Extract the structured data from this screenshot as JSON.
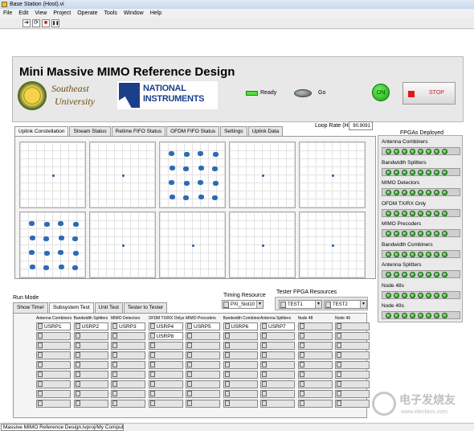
{
  "window": {
    "title": "Base Station (Host).vi"
  },
  "menu": [
    "File",
    "Edit",
    "View",
    "Project",
    "Operate",
    "Tools",
    "Window",
    "Help"
  ],
  "toolbar": {
    "run": "➔",
    "run_continuous": "⟳",
    "abort": "■",
    "pause": "❚❚"
  },
  "header": {
    "title": "Mini Massive MIMO Reference Design",
    "seu_line1": "Southeast",
    "seu_line2": "University",
    "ni_line1": "NATIONAL",
    "ni_line2": "INSTRUMENTS",
    "ready_label": "Ready",
    "go_label": "Go",
    "on_label": "ON",
    "stop_label": "STOP"
  },
  "loop_rate": {
    "label": "Loop Rate (Hz)",
    "value": "90.9091"
  },
  "tabs": [
    "Uplink Constellation",
    "Stream Status",
    "Retime FIFO Status",
    "OFDM FIFO Status",
    "Settings",
    "Uplink Data"
  ],
  "fpgas": {
    "title": "FPGAs Deployed",
    "rows": [
      "Antenna Combiners",
      "Bandwidth Splitters",
      "MIMO Detectors",
      "OFDM TX/RX Only",
      "MIMO Precoders",
      "Bandwidth Combiners",
      "Antenna Splitters",
      "Node 48s",
      "Node 49s"
    ],
    "led_count": 8
  },
  "run_mode": {
    "label": "Run Mode",
    "tabs": [
      "Show Time!",
      "Subsystem Test",
      "Unit Test",
      "Tester to Tester"
    ]
  },
  "timing": {
    "label": "Timing Resource",
    "value": "PXI_Slot10"
  },
  "tester": {
    "label": "Tester FPGA Resources",
    "sel1": "TEST1",
    "sel2": "TEST2"
  },
  "subsystem": {
    "columns": [
      {
        "header": "Antenna Combiners",
        "values": [
          "USRP1"
        ]
      },
      {
        "header": "Bandwidth Splitters",
        "values": [
          "USRP2"
        ]
      },
      {
        "header": "MIMO Detectors",
        "values": [
          "USRP3"
        ]
      },
      {
        "header": "OFDM TX/RX Onlys",
        "values": [
          "USRP4",
          "USRP8"
        ]
      },
      {
        "header": "MIMO Precoders",
        "values": [
          "USRP5"
        ]
      },
      {
        "header": "Bandwidth Combiners",
        "values": [
          "USRP6"
        ]
      },
      {
        "header": "Antenna Splitters",
        "values": [
          "USRP7"
        ]
      },
      {
        "header": "Node 48",
        "values": []
      },
      {
        "header": "Node 49",
        "values": []
      }
    ]
  },
  "status_bar": "Massive MIMO Reference Design.lvproj/My Computer",
  "watermark": {
    "cn": "电子发烧友",
    "url": "www.elecfans.com"
  }
}
